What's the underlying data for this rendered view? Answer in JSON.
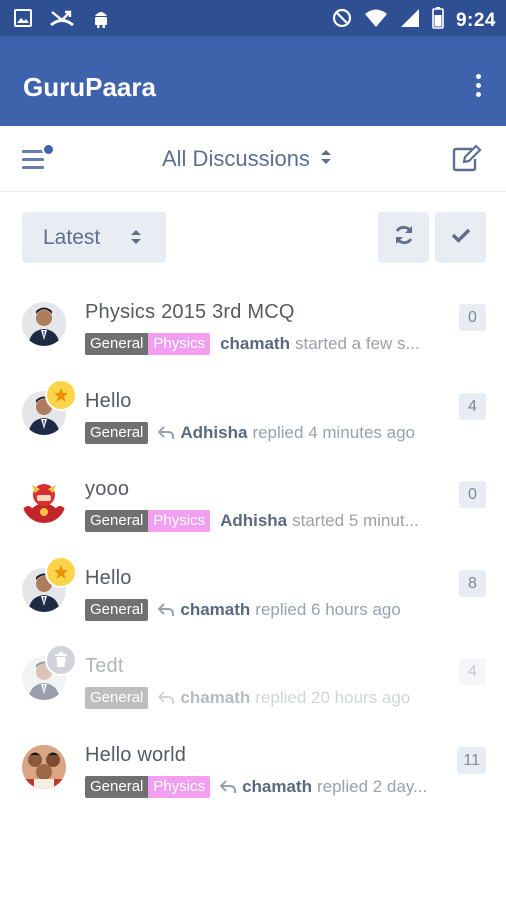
{
  "status_bar": {
    "time": "9:24",
    "left_icons": [
      "image-icon",
      "call-missed-icon",
      "android-icon"
    ],
    "right_icons": [
      "do-not-disturb-icon",
      "wifi-icon",
      "signal-icon",
      "battery-icon"
    ]
  },
  "app_bar": {
    "title": "GuruPaara",
    "more_icon": "more-vert-icon"
  },
  "subheader": {
    "menu_icon": "menu-notification-icon",
    "filter_label": "All Discussions",
    "compose_icon": "compose-icon"
  },
  "toolbar": {
    "sort_label": "Latest",
    "refresh_icon": "refresh-icon",
    "mark_read_icon": "check-icon"
  },
  "colors": {
    "status_bar": "#2f4f93",
    "app_bar": "#3f62ad",
    "tag_general": "#707070",
    "tag_physics": "#f09ff1",
    "star_badge": "#fcd44a"
  },
  "discussions": [
    {
      "title": "Physics 2015 3rd MCQ",
      "tags": [
        "General",
        "Physics"
      ],
      "user": "chamath",
      "activity": "started a few s...",
      "replied": false,
      "count": "0",
      "badge": "",
      "faded": false
    },
    {
      "title": "Hello",
      "tags": [
        "General"
      ],
      "user": "Adhisha",
      "activity": "replied 4 minutes ago",
      "replied": true,
      "count": "4",
      "badge": "star",
      "faded": false
    },
    {
      "title": "yooo",
      "tags": [
        "General",
        "Physics"
      ],
      "user": "Adhisha",
      "activity": "started 5 minut...",
      "replied": false,
      "count": "0",
      "badge": "",
      "faded": false
    },
    {
      "title": "Hello",
      "tags": [
        "General"
      ],
      "user": "chamath",
      "activity": "replied 6 hours ago",
      "replied": true,
      "count": "8",
      "badge": "star",
      "faded": false
    },
    {
      "title": "Tedt",
      "tags": [
        "General"
      ],
      "user": "chamath",
      "activity": "replied 20 hours ago",
      "replied": true,
      "count": "4",
      "badge": "trash",
      "faded": true
    },
    {
      "title": "Hello world",
      "tags": [
        "General",
        "Physics"
      ],
      "user": "chamath",
      "activity": "replied 2 day...",
      "replied": true,
      "count": "11",
      "badge": "",
      "faded": false
    }
  ]
}
